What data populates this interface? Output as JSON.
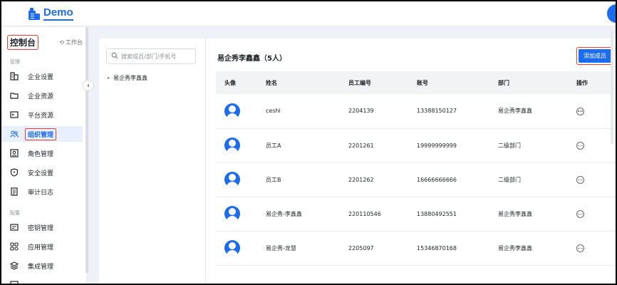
{
  "app": {
    "logo_text": "Demo",
    "brand_color": "#1d6cf0",
    "highlight_color": "#e8402c"
  },
  "sidebar": {
    "console_title": "控制台",
    "workbench_label": "工作台",
    "groups": [
      {
        "label": "管理"
      },
      {
        "label": "配置"
      }
    ],
    "items": [
      {
        "label": "企业设置",
        "icon": "building-icon"
      },
      {
        "label": "企业资源",
        "icon": "folder-icon"
      },
      {
        "label": "平台资源",
        "icon": "platform-icon"
      },
      {
        "label": "组织管理",
        "icon": "people-icon",
        "active": true
      },
      {
        "label": "角色管理",
        "icon": "role-icon"
      },
      {
        "label": "安全设置",
        "icon": "shield-icon"
      },
      {
        "label": "审计日志",
        "icon": "log-icon"
      },
      {
        "label": "密钥管理",
        "icon": "key-icon"
      },
      {
        "label": "应用管理",
        "icon": "apps-icon"
      },
      {
        "label": "集成管理",
        "icon": "layers-icon"
      }
    ]
  },
  "tree": {
    "search_placeholder": "搜索成员/部门/手机号",
    "root_node": "易企秀李鑫鑫"
  },
  "content": {
    "dept_title": "易企秀李鑫鑫（5人）",
    "add_button": "添加成员",
    "columns": [
      "头像",
      "姓名",
      "员工编号",
      "账号",
      "部门",
      "操作"
    ],
    "rows": [
      {
        "name": "ceshi",
        "emp_id": "2204139",
        "account": "13388150127",
        "dept": "易企秀李鑫鑫"
      },
      {
        "name": "员工A",
        "emp_id": "2201261",
        "account": "19999999999",
        "dept": "二级部门"
      },
      {
        "name": "员工B",
        "emp_id": "2201262",
        "account": "16666666666",
        "dept": "二级部门"
      },
      {
        "name": "易企秀-李鑫鑫",
        "emp_id": "220110546",
        "account": "13880492551",
        "dept": "易企秀李鑫鑫"
      },
      {
        "name": "易企秀-龙慧",
        "emp_id": "2205097",
        "account": "15346870168",
        "dept": "易企秀李鑫鑫"
      }
    ]
  }
}
